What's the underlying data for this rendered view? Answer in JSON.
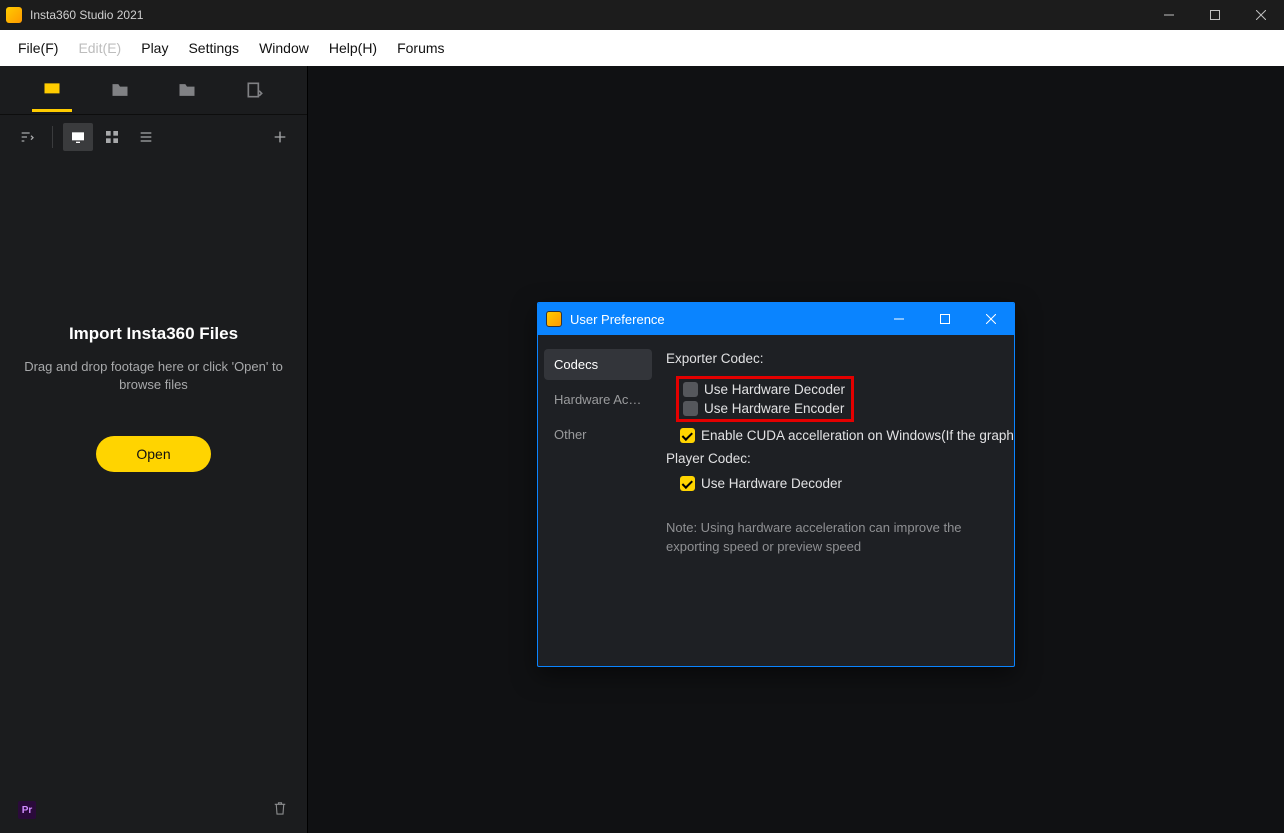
{
  "title": "Insta360 Studio 2021",
  "menu": {
    "file": "File(F)",
    "edit": "Edit(E)",
    "play": "Play",
    "settings": "Settings",
    "window": "Window",
    "help": "Help(H)",
    "forums": "Forums"
  },
  "sidebar": {
    "heading": "Import Insta360 Files",
    "subtext": "Drag and drop footage here or click 'Open' to browse files",
    "open_label": "Open",
    "pr_label": "Pr"
  },
  "dialog": {
    "title": "User Preference",
    "side_items": [
      "Codecs",
      "Hardware Acc...",
      "Other"
    ],
    "exporter_title": "Exporter Codec:",
    "use_hw_decoder": "Use Hardware Decoder",
    "use_hw_encoder": "Use Hardware Encoder",
    "enable_cuda": "Enable CUDA accelleration on Windows(If the graphics",
    "player_title": "Player Codec:",
    "player_decoder": "Use Hardware Decoder",
    "note": "Note: Using hardware acceleration can improve the exporting speed or preview speed"
  }
}
